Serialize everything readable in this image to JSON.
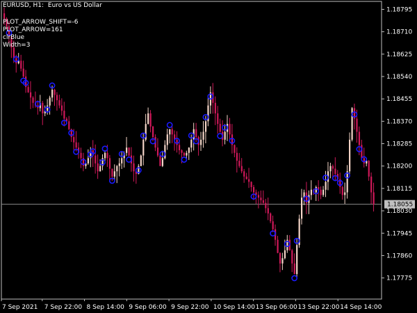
{
  "title": {
    "symbol": "EURUSD, H1:",
    "description": "Euro vs US Dollar"
  },
  "info_lines": [
    "PLOT_ARROW_SHIFT=-6",
    "PLOT_ARROW=161",
    "clrBlue",
    "Width=3"
  ],
  "colors": {
    "background": "#000000",
    "grid_frame": "#c0c0c0",
    "bull_candle": "#f5d5c8",
    "bear_candle": "#d1195a",
    "arrow": "#1a1aff",
    "current_price_label_bg": "#c0c0c0",
    "axis_text": "#ffffff"
  },
  "chart_data": {
    "type": "candlestick",
    "symbol": "EURUSD",
    "timeframe": "H1",
    "ylim": [
      1.177,
      1.1882
    ],
    "y_ticks": [
      "1.18795",
      "1.18710",
      "1.18625",
      "1.18540",
      "1.18455",
      "1.18370",
      "1.18285",
      "1.18200",
      "1.18115",
      "1.18030",
      "1.17945",
      "1.17860",
      "1.17775"
    ],
    "current_price": "1.18055",
    "x_ticks": [
      "7 Sep 2021",
      "7 Sep 22:00",
      "8 Sep 14:00",
      "9 Sep 06:00",
      "9 Sep 22:00",
      "10 Sep 14:00",
      "13 Sep 06:00",
      "13 Sep 22:00",
      "14 Sep 14:00"
    ],
    "closes": [
      1.1876,
      1.1873,
      1.1869,
      1.1865,
      1.1861,
      1.1859,
      1.186,
      1.1857,
      1.1854,
      1.185,
      1.1848,
      1.1846,
      1.1844,
      1.1843,
      1.1842,
      1.1844,
      1.184,
      1.1841,
      1.1843,
      1.1846,
      1.1849,
      1.1847,
      1.1845,
      1.1843,
      1.1841,
      1.1838,
      1.1837,
      1.1834,
      1.1831,
      1.1829,
      1.1827,
      1.1825,
      1.1823,
      1.182,
      1.1821,
      1.1823,
      1.1826,
      1.1824,
      1.1821,
      1.1818,
      1.182,
      1.1823,
      1.1825,
      1.1823,
      1.1819,
      1.1816,
      1.1818,
      1.182,
      1.1821,
      1.1823,
      1.1825,
      1.1827,
      1.1824,
      1.1821,
      1.1818,
      1.1817,
      1.182,
      1.1824,
      1.183,
      1.1836,
      1.184,
      1.1835,
      1.1831,
      1.1827,
      1.1824,
      1.182,
      1.1823,
      1.1828,
      1.1832,
      1.1834,
      1.1832,
      1.183,
      1.1828,
      1.1826,
      1.1825,
      1.1824,
      1.1825,
      1.1827,
      1.183,
      1.1834,
      1.1831,
      1.1828,
      1.183,
      1.1833,
      1.1837,
      1.1843,
      1.1848,
      1.1844,
      1.184,
      1.1836,
      1.1833,
      1.183,
      1.1833,
      1.1836,
      1.1832,
      1.1828,
      1.1825,
      1.1822,
      1.182,
      1.1818,
      1.1816,
      1.1815,
      1.1814,
      1.1812,
      1.181,
      1.1809,
      1.1808,
      1.1807,
      1.1806,
      1.1804,
      1.1802,
      1.1799,
      1.1796,
      1.1792,
      1.1787,
      1.1783,
      1.1785,
      1.1788,
      1.1792,
      1.1788,
      1.1783,
      1.1779,
      1.179,
      1.18,
      1.1808,
      1.181,
      1.1806,
      1.1809,
      1.1811,
      1.181,
      1.1812,
      1.1811,
      1.1809,
      1.1811,
      1.1814,
      1.1818,
      1.182,
      1.1819,
      1.1817,
      1.1815,
      1.1812,
      1.1809,
      1.181,
      1.1818,
      1.183,
      1.1842,
      1.1838,
      1.1833,
      1.1828,
      1.1823,
      1.1821,
      1.1822,
      1.1816,
      1.181,
      1.18055
    ],
    "up_arrow_indices": [
      2,
      5,
      9,
      14,
      20,
      28,
      33,
      37,
      42,
      49,
      58,
      66,
      69,
      72,
      78,
      84,
      92,
      95,
      122,
      126,
      134,
      140,
      146,
      150
    ],
    "down_arrow_indices": [
      8,
      18,
      25,
      30,
      36,
      41,
      45,
      52,
      56,
      62,
      75,
      80,
      86,
      90,
      104,
      112,
      118,
      121,
      130,
      138,
      143,
      148
    ]
  }
}
